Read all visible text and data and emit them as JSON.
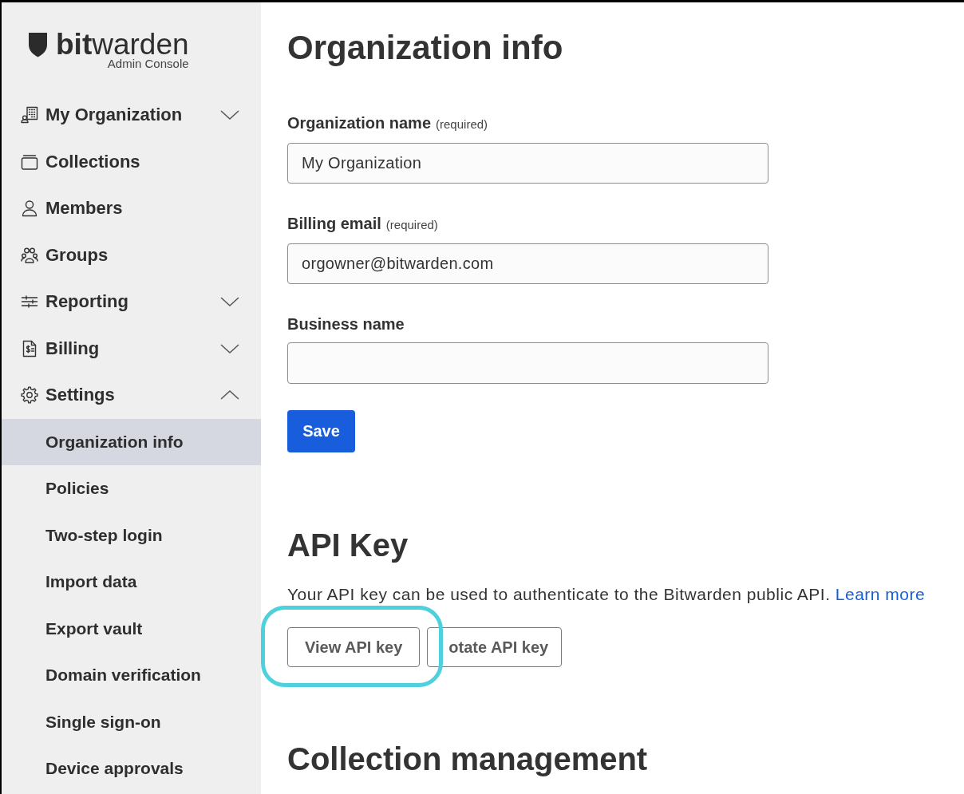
{
  "sidebar": {
    "logo": {
      "wordmark": "**bit**warden",
      "subtitle": "Admin Console"
    },
    "items": [
      {
        "label": "My Organization",
        "selected": false,
        "expanded": false
      },
      {
        "label": "Collections",
        "selected": false
      },
      {
        "label": "Members",
        "selected": false
      },
      {
        "label": "Groups",
        "selected": false
      },
      {
        "label": "Reporting",
        "selected": false,
        "expanded": false
      },
      {
        "label": "Billing",
        "selected": false,
        "expanded": false
      },
      {
        "label": "Settings",
        "selected": false,
        "expanded": true,
        "children": [
          {
            "label": "Organization info",
            "selected": true
          },
          {
            "label": "Policies",
            "selected": false
          },
          {
            "label": "Two-step login",
            "selected": false
          },
          {
            "label": "Import data",
            "selected": false
          },
          {
            "label": "Export vault",
            "selected": false
          },
          {
            "label": "Domain verification",
            "selected": false
          },
          {
            "label": "Single sign-on",
            "selected": false
          },
          {
            "label": "Device approvals",
            "selected": false
          }
        ]
      }
    ]
  },
  "main": {
    "title": "Organization info",
    "fields": [
      {
        "label": "Organization name",
        "note": "(required)",
        "value": "My Organization"
      },
      {
        "label": "Billing email",
        "note": "(required)",
        "value": "orgowner@bitwarden.com"
      },
      {
        "label": "Business name"
      }
    ],
    "save_button": "Save",
    "api_key": {
      "title": "API Key",
      "description": "Your API key can be used to authenticate to the Bitwarden public API.",
      "link": "Learn more",
      "buttons": [
        {
          "label": "View API key",
          "highlighted": true
        },
        {
          "label": "otate API key",
          "highlighted": false
        }
      ]
    },
    "next_section": {
      "title": "Collection management"
    }
  }
}
